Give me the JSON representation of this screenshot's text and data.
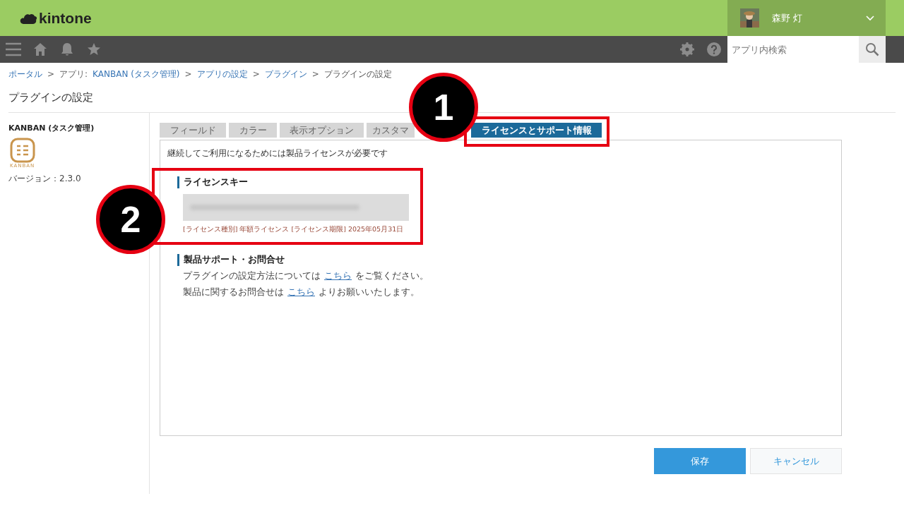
{
  "header": {
    "logo": "kintone",
    "user": {
      "name": "森野 灯"
    }
  },
  "toolbar": {
    "search": {
      "placeholder": "アプリ内検索"
    }
  },
  "breadcrumb": [
    {
      "label": "ポータル",
      "link": true
    },
    {
      "separator": ">",
      "prefix": "アプリ: ",
      "label": "KANBAN (タスク管理)",
      "link": true
    },
    {
      "separator": ">",
      "label": "アプリの設定",
      "link": true
    },
    {
      "separator": ">",
      "label": "プラグイン",
      "link": true
    },
    {
      "separator": ">",
      "label": "プラグインの設定",
      "link": false
    }
  ],
  "page_title": "プラグインの設定",
  "plugin": {
    "name": "KANBAN (タスク管理)",
    "logo_text": "KANBAN",
    "version": "バージョン：2.3.0"
  },
  "tabs": [
    {
      "label": "フィールド",
      "selected": false
    },
    {
      "label": "カラー",
      "selected": false
    },
    {
      "label": "表示オプション",
      "selected": false
    },
    {
      "label": "カスタマ",
      "selected": false
    },
    {
      "label": "ライセンスとサポート情報",
      "selected": true
    }
  ],
  "notice": "継続してご利用になるためには製品ライセンスが必要です",
  "license": {
    "heading": "ライセンスキー",
    "info": "[ライセンス種別] 年額ライセンス [ライセンス期限] 2025年05月31日"
  },
  "support": {
    "heading": "製品サポート・お問合せ",
    "lines": [
      {
        "before": "プラグインの設定方法については",
        "link": "こちら",
        "after": "をご覧ください。"
      },
      {
        "before": "製品に関するお問合せは",
        "link": "こちら",
        "after": "よりお願いいたします。"
      }
    ]
  },
  "buttons": [
    {
      "label": "保存",
      "kind": "primary"
    },
    {
      "label": "キャンセル",
      "kind": "secondary"
    }
  ],
  "callouts": [
    "1",
    "2"
  ]
}
